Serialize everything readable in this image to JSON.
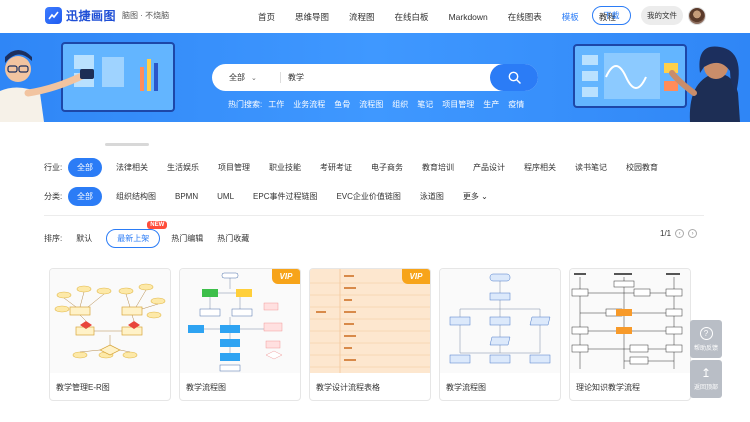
{
  "brand": {
    "name": "迅捷画图",
    "tagline": "脑图 · 不烧脑"
  },
  "nav": {
    "items": [
      {
        "label": "首页",
        "active": false
      },
      {
        "label": "思维导图",
        "active": false
      },
      {
        "label": "流程图",
        "active": false
      },
      {
        "label": "在线白板",
        "active": false
      },
      {
        "label": "Markdown",
        "active": false
      },
      {
        "label": "在线图表",
        "active": false
      },
      {
        "label": "模板",
        "active": true
      },
      {
        "label": "教程",
        "active": false
      }
    ],
    "download": "下载",
    "my_files": "我的文件"
  },
  "search": {
    "scope": "全部",
    "value": "教学",
    "hot_label": "热门搜索:",
    "hot_items": [
      "工作",
      "业务流程",
      "鱼骨",
      "流程图",
      "组织",
      "笔记",
      "项目管理",
      "生产",
      "疫情"
    ]
  },
  "filters": {
    "industry": {
      "label": "行业:",
      "items": [
        "全部",
        "法律相关",
        "生活娱乐",
        "项目管理",
        "职业技能",
        "考研考证",
        "电子商务",
        "教育培训",
        "产品设计",
        "程序相关",
        "读书笔记",
        "校园教育"
      ],
      "active_index": 0
    },
    "category": {
      "label": "分类:",
      "items": [
        "全部",
        "组织结构图",
        "BPMN",
        "UML",
        "EPC事件过程链图",
        "EVC企业价值链图",
        "泳道图",
        "更多"
      ],
      "active_index": 0
    }
  },
  "sort": {
    "label": "排序:",
    "items": [
      "默认",
      "最新上架",
      "热门编辑",
      "热门收藏"
    ],
    "active_index": 1,
    "new_badge": "NEW"
  },
  "pager": {
    "text": "1/1"
  },
  "cards": [
    {
      "title": "教学管理E-R图",
      "vip": false
    },
    {
      "title": "教学流程图",
      "vip": true
    },
    {
      "title": "教学设计流程表格",
      "vip": true
    },
    {
      "title": "教学流程图",
      "vip": false
    },
    {
      "title": "理论知识教学流程",
      "vip": false
    }
  ],
  "vip_label": "VIP",
  "side_tools": {
    "feedback": "帮助反馈",
    "back_top": "返回顶部"
  },
  "colors": {
    "primary": "#2b7cf6",
    "banner": "#3a92fb",
    "vip": "#f7a41a",
    "new": "#ff4d3a"
  }
}
